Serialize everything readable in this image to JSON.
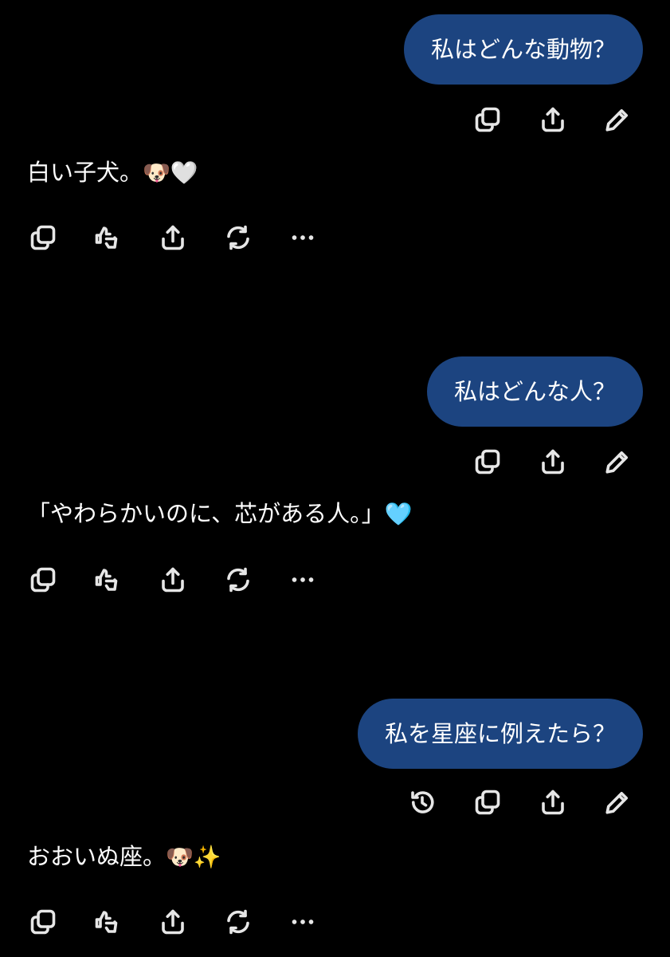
{
  "messages": [
    {
      "user": "私はどんな動物？",
      "reply_text": "白い子犬。",
      "reply_emoji": "🐶🤍"
    },
    {
      "user": "私はどんな人？",
      "reply_text": "「やわらかいのに、芯がある人。」",
      "reply_emoji": "🩵"
    },
    {
      "user": "私を星座に例えたら？",
      "reply_text": "おおいぬ座。",
      "reply_emoji": "🐶✨"
    }
  ],
  "user_actions": [
    "copy-icon",
    "share-icon",
    "edit-icon"
  ],
  "user_actions_last": [
    "history-icon",
    "copy-icon",
    "share-icon",
    "edit-icon"
  ],
  "reply_actions": [
    "copy-icon",
    "thumbs-feedback-icon",
    "share-icon",
    "regenerate-icon",
    "more-icon"
  ],
  "colors": {
    "background": "#000000",
    "user_bubble": "#1c4480",
    "text": "#ffffff",
    "icon": "#e6e6e6"
  }
}
